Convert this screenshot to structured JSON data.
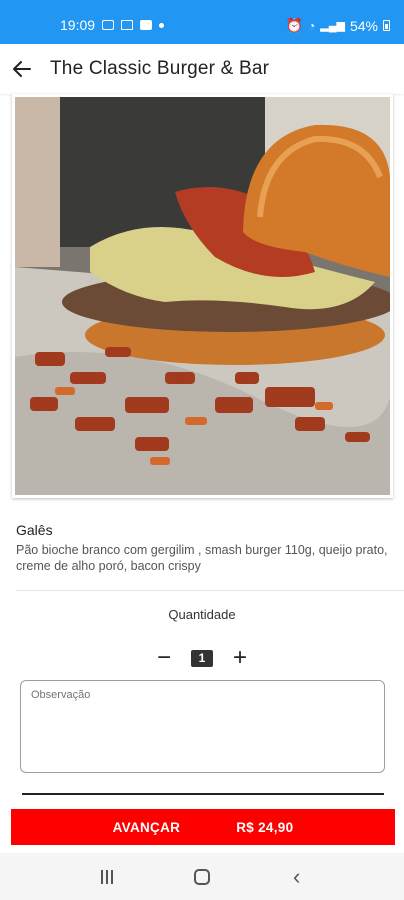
{
  "status_bar": {
    "time": "19:09",
    "battery": "54%",
    "left_icons": [
      "gallery-icon",
      "cast-icon",
      "message-icon",
      "dot-icon"
    ],
    "right_icons": [
      "alarm-icon",
      "wifi-icon",
      "signal-icon",
      "battery-icon"
    ]
  },
  "app_bar": {
    "back_icon": "arrow-left-icon",
    "title": "The Classic Burger & Bar"
  },
  "product": {
    "name": "Galês",
    "description": "Pão bioche branco com gergilim , smash burger 110g, queijo prato, creme de alho poró, bacon crispy"
  },
  "quantity": {
    "label": "Quantidade",
    "value": "1",
    "minus": "−",
    "plus": "+"
  },
  "observation": {
    "placeholder": "Observação",
    "value": ""
  },
  "cta": {
    "label": "AVANÇAR",
    "price": "R$ 24,90",
    "color": "#ff0000"
  },
  "nav_bar": {
    "back_glyph": "‹"
  },
  "colors": {
    "status_bar": "#2196f3",
    "cta": "#ff0000"
  }
}
